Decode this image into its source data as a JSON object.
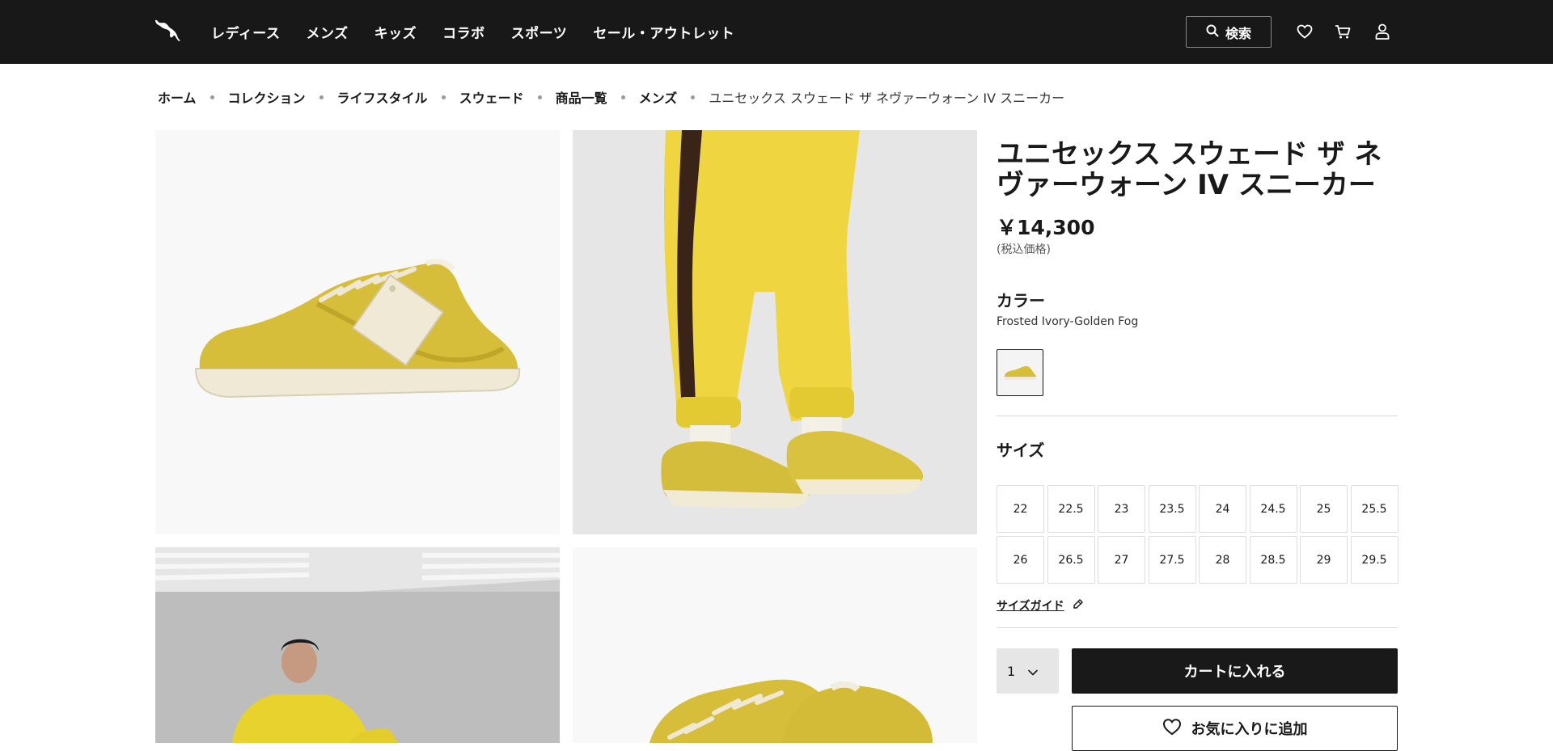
{
  "header": {
    "nav": [
      "レディース",
      "メンズ",
      "キッズ",
      "コラボ",
      "スポーツ",
      "セール・アウトレット"
    ],
    "search_label": "検索",
    "icons": [
      "puma-logo-icon",
      "search-icon",
      "heart-icon",
      "cart-icon",
      "user-icon"
    ]
  },
  "breadcrumb": {
    "items": [
      "ホーム",
      "コレクション",
      "ライフスタイル",
      "スウェード",
      "商品一覧",
      "メンズ"
    ],
    "current": "ユニセックス スウェード ザ ネヴァーウォーン IV スニーカー"
  },
  "gallery": {
    "images": [
      "shoe-side-view",
      "model-legs-yellow-pants",
      "model-seated-yellow-hoodie",
      "pair-of-shoes"
    ]
  },
  "product": {
    "title": "ユニセックス スウェード ザ ネヴァーウォーン IV スニーカー",
    "price": "￥14,300",
    "tax_note": "(税込価格)",
    "color_heading": "カラー",
    "color_name": "Frosted Ivory-Golden Fog",
    "size_heading": "サイズ",
    "sizes": [
      "22",
      "22.5",
      "23",
      "23.5",
      "24",
      "24.5",
      "25",
      "25.5",
      "26",
      "26.5",
      "27",
      "27.5",
      "28",
      "28.5",
      "29",
      "29.5"
    ],
    "size_guide": "サイズガイド",
    "quantity": "1",
    "add_to_cart": "カートに入れる",
    "add_to_wishlist": "お気に入りに追加"
  },
  "colors": {
    "header_bg": "#181818",
    "accent_yellow": "#d9c238",
    "button_dark": "#191919"
  }
}
